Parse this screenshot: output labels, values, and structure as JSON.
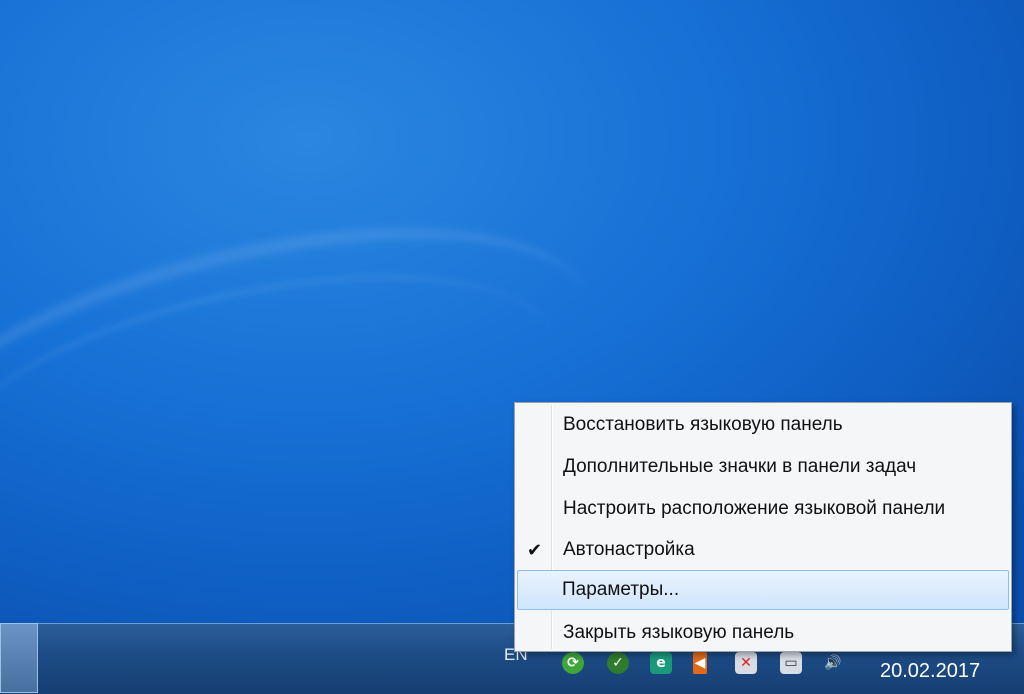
{
  "desktop": {
    "background_color": "#1771d6"
  },
  "context_menu": {
    "items": [
      {
        "label": "Восстановить языковую панель",
        "checked": false,
        "highlighted": false
      },
      {
        "label": "Дополнительные значки в панели задач",
        "checked": false,
        "highlighted": false
      },
      {
        "label": "Настроить расположение языковой панели",
        "checked": false,
        "highlighted": false
      },
      {
        "label": "Автонастройка",
        "checked": true,
        "highlighted": false
      },
      {
        "label": "Параметры...",
        "checked": false,
        "highlighted": true
      },
      {
        "label": "Закрыть языковую панель",
        "checked": false,
        "highlighted": false
      }
    ],
    "check_glyph": "✔"
  },
  "taskbar": {
    "language": "EN",
    "clock_date": "20.02.2017",
    "tray_icons": [
      "refresh-icon",
      "shield-check-icon",
      "e-icon",
      "speaker-icon",
      "network-x-icon",
      "display-icon",
      "volume-icon"
    ]
  }
}
